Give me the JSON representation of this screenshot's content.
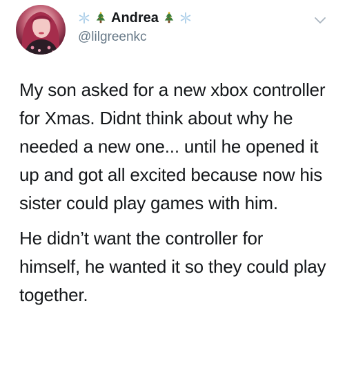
{
  "tweet": {
    "author": {
      "display_name": "Andrea",
      "handle": "@lilgreenkc",
      "avatar_icon": "avatar-photo",
      "name_decorations": [
        "snowflake-icon",
        "christmas-tree-icon",
        "christmas-tree-icon",
        "snowflake-icon"
      ]
    },
    "menu_icon": "chevron-down-icon",
    "text": {
      "paragraph_1": "My son asked for a new xbox controller for Xmas. Didnt think about why he needed a new one... until he opened it up and got all excited because now his sister could play games with him.",
      "paragraph_2": "He didn’t want the controller for himself, he wanted it so they could play together."
    }
  },
  "colors": {
    "text": "#14171a",
    "secondary_text": "#657786",
    "tree_green": "#3b7d3a",
    "snowflake_blue": "#a9cde8"
  }
}
